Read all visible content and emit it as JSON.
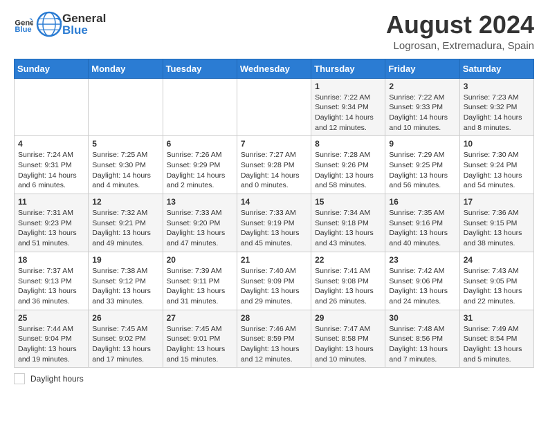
{
  "header": {
    "logo_general": "General",
    "logo_blue": "Blue",
    "main_title": "August 2024",
    "subtitle": "Logrosan, Extremadura, Spain"
  },
  "calendar": {
    "days_of_week": [
      "Sunday",
      "Monday",
      "Tuesday",
      "Wednesday",
      "Thursday",
      "Friday",
      "Saturday"
    ],
    "weeks": [
      [
        {
          "day": "",
          "info": ""
        },
        {
          "day": "",
          "info": ""
        },
        {
          "day": "",
          "info": ""
        },
        {
          "day": "",
          "info": ""
        },
        {
          "day": "1",
          "info": "Sunrise: 7:22 AM\nSunset: 9:34 PM\nDaylight: 14 hours and 12 minutes."
        },
        {
          "day": "2",
          "info": "Sunrise: 7:22 AM\nSunset: 9:33 PM\nDaylight: 14 hours and 10 minutes."
        },
        {
          "day": "3",
          "info": "Sunrise: 7:23 AM\nSunset: 9:32 PM\nDaylight: 14 hours and 8 minutes."
        }
      ],
      [
        {
          "day": "4",
          "info": "Sunrise: 7:24 AM\nSunset: 9:31 PM\nDaylight: 14 hours and 6 minutes."
        },
        {
          "day": "5",
          "info": "Sunrise: 7:25 AM\nSunset: 9:30 PM\nDaylight: 14 hours and 4 minutes."
        },
        {
          "day": "6",
          "info": "Sunrise: 7:26 AM\nSunset: 9:29 PM\nDaylight: 14 hours and 2 minutes."
        },
        {
          "day": "7",
          "info": "Sunrise: 7:27 AM\nSunset: 9:28 PM\nDaylight: 14 hours and 0 minutes."
        },
        {
          "day": "8",
          "info": "Sunrise: 7:28 AM\nSunset: 9:26 PM\nDaylight: 13 hours and 58 minutes."
        },
        {
          "day": "9",
          "info": "Sunrise: 7:29 AM\nSunset: 9:25 PM\nDaylight: 13 hours and 56 minutes."
        },
        {
          "day": "10",
          "info": "Sunrise: 7:30 AM\nSunset: 9:24 PM\nDaylight: 13 hours and 54 minutes."
        }
      ],
      [
        {
          "day": "11",
          "info": "Sunrise: 7:31 AM\nSunset: 9:23 PM\nDaylight: 13 hours and 51 minutes."
        },
        {
          "day": "12",
          "info": "Sunrise: 7:32 AM\nSunset: 9:21 PM\nDaylight: 13 hours and 49 minutes."
        },
        {
          "day": "13",
          "info": "Sunrise: 7:33 AM\nSunset: 9:20 PM\nDaylight: 13 hours and 47 minutes."
        },
        {
          "day": "14",
          "info": "Sunrise: 7:33 AM\nSunset: 9:19 PM\nDaylight: 13 hours and 45 minutes."
        },
        {
          "day": "15",
          "info": "Sunrise: 7:34 AM\nSunset: 9:18 PM\nDaylight: 13 hours and 43 minutes."
        },
        {
          "day": "16",
          "info": "Sunrise: 7:35 AM\nSunset: 9:16 PM\nDaylight: 13 hours and 40 minutes."
        },
        {
          "day": "17",
          "info": "Sunrise: 7:36 AM\nSunset: 9:15 PM\nDaylight: 13 hours and 38 minutes."
        }
      ],
      [
        {
          "day": "18",
          "info": "Sunrise: 7:37 AM\nSunset: 9:13 PM\nDaylight: 13 hours and 36 minutes."
        },
        {
          "day": "19",
          "info": "Sunrise: 7:38 AM\nSunset: 9:12 PM\nDaylight: 13 hours and 33 minutes."
        },
        {
          "day": "20",
          "info": "Sunrise: 7:39 AM\nSunset: 9:11 PM\nDaylight: 13 hours and 31 minutes."
        },
        {
          "day": "21",
          "info": "Sunrise: 7:40 AM\nSunset: 9:09 PM\nDaylight: 13 hours and 29 minutes."
        },
        {
          "day": "22",
          "info": "Sunrise: 7:41 AM\nSunset: 9:08 PM\nDaylight: 13 hours and 26 minutes."
        },
        {
          "day": "23",
          "info": "Sunrise: 7:42 AM\nSunset: 9:06 PM\nDaylight: 13 hours and 24 minutes."
        },
        {
          "day": "24",
          "info": "Sunrise: 7:43 AM\nSunset: 9:05 PM\nDaylight: 13 hours and 22 minutes."
        }
      ],
      [
        {
          "day": "25",
          "info": "Sunrise: 7:44 AM\nSunset: 9:04 PM\nDaylight: 13 hours and 19 minutes."
        },
        {
          "day": "26",
          "info": "Sunrise: 7:45 AM\nSunset: 9:02 PM\nDaylight: 13 hours and 17 minutes."
        },
        {
          "day": "27",
          "info": "Sunrise: 7:45 AM\nSunset: 9:01 PM\nDaylight: 13 hours and 15 minutes."
        },
        {
          "day": "28",
          "info": "Sunrise: 7:46 AM\nSunset: 8:59 PM\nDaylight: 13 hours and 12 minutes."
        },
        {
          "day": "29",
          "info": "Sunrise: 7:47 AM\nSunset: 8:58 PM\nDaylight: 13 hours and 10 minutes."
        },
        {
          "day": "30",
          "info": "Sunrise: 7:48 AM\nSunset: 8:56 PM\nDaylight: 13 hours and 7 minutes."
        },
        {
          "day": "31",
          "info": "Sunrise: 7:49 AM\nSunset: 8:54 PM\nDaylight: 13 hours and 5 minutes."
        }
      ]
    ]
  },
  "footer": {
    "daylight_label": "Daylight hours"
  }
}
